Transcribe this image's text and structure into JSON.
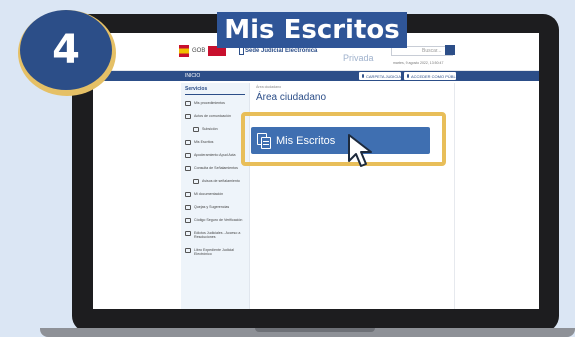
{
  "step": {
    "number": "4"
  },
  "banner": {
    "title": "Mis Escritos"
  },
  "site": {
    "gov_label": "GOB",
    "name": "Sede Judicial Electrónica",
    "privada": "Privada",
    "search_placeholder": "Buscar...",
    "header_small": "martes, 9 agosto 2022, 13:50:47"
  },
  "nav": {
    "home": "INICIO",
    "btn1": "CARPETA JUDICIAL",
    "btn2": "ACCEDER COMO PÚBLICO"
  },
  "sidebar": {
    "title": "Servicios",
    "items": [
      {
        "label": "Mis procedimientos",
        "sub": false
      },
      {
        "label": "Actos de comunicación",
        "sub": false
      },
      {
        "label": "Subsición",
        "sub": true
      },
      {
        "label": "Mis Escritos",
        "sub": false
      },
      {
        "label": "Apoderamiento Apud Acta",
        "sub": false
      },
      {
        "label": "Consulta de Señalamientos",
        "sub": false
      },
      {
        "label": "Avisos de señalamiento",
        "sub": true
      },
      {
        "label": "Mi documentación",
        "sub": false
      },
      {
        "label": "Quejas y Sugerencias",
        "sub": false
      },
      {
        "label": "Código Seguro de Verificación",
        "sub": false
      },
      {
        "label": "Edictos Judiciales - Acceso a Resoluciones",
        "sub": false
      },
      {
        "label": "Libro Expediente Judicial Electrónico",
        "sub": false
      }
    ]
  },
  "main": {
    "breadcrumb": "Área ciudadano",
    "title": "Área ciudadano",
    "action_button": "Mis Escritos"
  },
  "colors": {
    "background": "#dbe6f4",
    "brand_blue": "#2c4e88",
    "button_blue": "#3f6fb1",
    "highlight_gold": "#e8be59"
  }
}
